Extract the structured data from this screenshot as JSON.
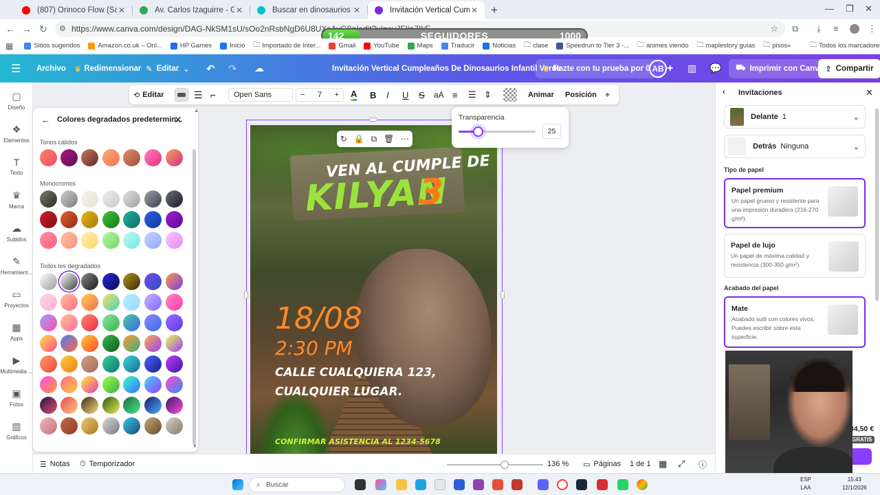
{
  "browser": {
    "tabs": [
      {
        "title": "(807) Orinoco Flow (Sail Aw",
        "favicon_color": "#ff0000",
        "active": false
      },
      {
        "title": "Av. Carlos Izaguirre - Google M",
        "favicon_color": "#34a853",
        "active": false
      },
      {
        "title": "Buscar en dinosaurios - Canva",
        "favicon_color": "#00c4cc",
        "active": false
      },
      {
        "title": "Invitación Vertical Cumpleaños",
        "favicon_color": "#7d2ae8",
        "active": true
      }
    ],
    "url": "https://www.canva.com/design/DAG-NkSM1sU/sOo2nRsbNgD6U8UXsAyG8g/edit?ui=eyJFIjp7IkE",
    "bookmarks": [
      {
        "label": "Sitios sugeridos",
        "icon": "#4285f4"
      },
      {
        "label": "Amazon.co.uk – Onl...",
        "icon": "#ff9900"
      },
      {
        "label": "HP Games",
        "icon": "#1a73e8"
      },
      {
        "label": "Inicio",
        "icon": "#1877f2"
      },
      {
        "label": "Importado de Inter...",
        "icon": "folder"
      },
      {
        "label": "Gmail",
        "icon": "#ea4335"
      },
      {
        "label": "YouTube",
        "icon": "#ff0000"
      },
      {
        "label": "Maps",
        "icon": "#34a853"
      },
      {
        "label": "Traducir",
        "icon": "#4285f4"
      },
      {
        "label": "Noticias",
        "icon": "#1a73e8"
      },
      {
        "label": "clase",
        "icon": "folder"
      },
      {
        "label": "Speedrun to Tier 3 -...",
        "icon": "#3b5998"
      },
      {
        "label": "animes viendo",
        "icon": "folder"
      },
      {
        "label": "maplestory guias",
        "icon": "folder"
      },
      {
        "label": "pisos",
        "icon": "folder"
      }
    ],
    "all_bookmarks": "Todos los marcadores"
  },
  "followers": {
    "current": "142",
    "label": "SEGUIDORES",
    "goal": "1000",
    "progress": 0.142
  },
  "canva_bar": {
    "archivo": "Archivo",
    "redimensionar": "Redimensionar",
    "editar": "Editar",
    "doc_title": "Invitación Vertical Cumpleaños De Dinosaurios Infantil Verde",
    "trial": "Hazte con tu prueba por 0 €",
    "avatar": "AB",
    "imprimir": "Imprimir con Canva",
    "compartir": "Compartir"
  },
  "left_nav": [
    {
      "label": "Diseño",
      "icon": "▢"
    },
    {
      "label": "Elementos",
      "icon": "❖"
    },
    {
      "label": "Texto",
      "icon": "T"
    },
    {
      "label": "Marca",
      "icon": "♛"
    },
    {
      "label": "Subidos",
      "icon": "☁"
    },
    {
      "label": "Herramient...",
      "icon": "✎"
    },
    {
      "label": "Proyectos",
      "icon": "▭"
    },
    {
      "label": "Apps",
      "icon": "▦"
    },
    {
      "label": "Multimedia ...",
      "icon": "▶"
    },
    {
      "label": "Fotos",
      "icon": "▣"
    },
    {
      "label": "Gráficos",
      "icon": "▥"
    }
  ],
  "gradient_panel": {
    "title": "Colores degradados predetermin...",
    "section_warm": "Tonos cálidos",
    "section_mono": "Monocromos",
    "section_all": "Todos los degradados"
  },
  "text_toolbar": {
    "editar": "Editar",
    "font": "Open Sans",
    "size": "7",
    "animar": "Animar",
    "posicion": "Posición"
  },
  "transparency": {
    "label": "Transparencia",
    "value": "25",
    "fraction": 0.25
  },
  "poster": {
    "line1": "VEN AL CUMPLE DE",
    "name": "KILYAN",
    "age": "3",
    "date": "18/08",
    "time": "2:30 PM",
    "address1": "CALLE CUALQUIERA 123,",
    "address2": "CUALQUIER LUGAR.",
    "rsvp": "CONFIRMAR ASISTENCIA AL 1234-5678"
  },
  "bottom_bar": {
    "notas": "Notas",
    "temporizador": "Temporizador",
    "zoom": "136 %",
    "paginas": "Páginas",
    "pager": "1 de 1",
    "zoom_fraction": 0.6
  },
  "right_panel": {
    "title": "Invitaciones",
    "delante_label": "Delante",
    "delante_value": "1",
    "detras_label": "Detrás",
    "detras_value": "Ninguna",
    "paper_section": "Tipo de papel",
    "papers": [
      {
        "name": "Papel premium",
        "desc": "Un papel grueso y resistente para una impresión duradera (216-270 g/m²).",
        "selected": true
      },
      {
        "name": "Papel de lujo",
        "desc": "Un papel de máxima calidad y resistencia (300-350 g/m²).",
        "selected": false
      }
    ],
    "finish_section": "Acabado del papel",
    "finish": {
      "name": "Mate",
      "desc": "Acabado sutil con colores vivos. Puedes escribir sobre esta superficie."
    },
    "price": "34,50 €",
    "gratis": "GRATIS"
  },
  "taskbar": {
    "search": "Buscar",
    "lang": "ESP",
    "lang2": "LAA",
    "time": "15:43",
    "date": "12/1/2026"
  }
}
